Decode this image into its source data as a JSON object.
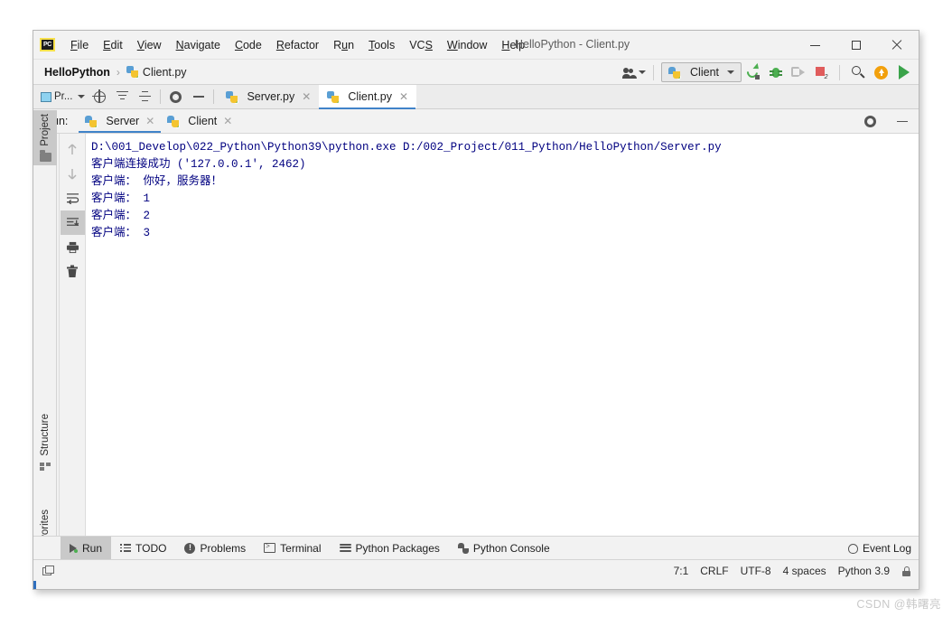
{
  "window": {
    "title": "HelloPython - Client.py",
    "logo_text": "PC",
    "controls": {
      "minimize": "minimize-icon",
      "maximize": "maximize-icon",
      "close": "close-icon"
    }
  },
  "menubar": {
    "items": [
      {
        "label": "File",
        "mnemonic": "F"
      },
      {
        "label": "Edit",
        "mnemonic": "E"
      },
      {
        "label": "View",
        "mnemonic": "V"
      },
      {
        "label": "Navigate",
        "mnemonic": "N"
      },
      {
        "label": "Code",
        "mnemonic": "C"
      },
      {
        "label": "Refactor",
        "mnemonic": "R"
      },
      {
        "label": "Run",
        "mnemonic": "u"
      },
      {
        "label": "Tools",
        "mnemonic": "T"
      },
      {
        "label": "VCS",
        "mnemonic": "S"
      },
      {
        "label": "Window",
        "mnemonic": "W"
      },
      {
        "label": "Help",
        "mnemonic": "H"
      }
    ]
  },
  "navbar": {
    "project": "HelloPython",
    "separator": "›",
    "file": "Client.py",
    "run_config": "Client",
    "icons": {
      "people": "people-icon",
      "rerun": "run-icon",
      "debug": "debug-icon",
      "coverage": "run-with-coverage-icon",
      "stop": "stop-icon",
      "search": "search-everywhere-icon",
      "update": "update-icon",
      "play": "play-icon"
    }
  },
  "editor_tabbar": {
    "project_chip": "Pr...",
    "tools": [
      "locate-icon",
      "expand-all-icon",
      "collapse-all-icon",
      "settings-icon",
      "hide-icon"
    ],
    "tabs": [
      {
        "label": "Server.py",
        "active": false
      },
      {
        "label": "Client.py",
        "active": true
      }
    ]
  },
  "run_window": {
    "label": "Run:",
    "tabs": [
      {
        "label": "Server",
        "active": true
      },
      {
        "label": "Client",
        "active": false
      }
    ],
    "header_icons": [
      "settings-icon",
      "hide-icon"
    ],
    "left_toolbar": [
      "rerun-icon",
      "wrench-icon",
      "stop-icon",
      "layout-icon",
      "pin-icon"
    ],
    "right_toolbar": [
      "up-arrow-icon",
      "down-arrow-icon",
      "soft-wrap-icon",
      "scroll-to-end-icon",
      "print-icon",
      "trash-icon"
    ],
    "console_lines": [
      "D:\\001_Develop\\022_Python\\Python39\\python.exe D:/002_Project/011_Python/HelloPython/Server.py",
      "客户端连接成功 ('127.0.0.1', 2462)",
      "客户端： 你好，服务器！",
      "客户端： 1",
      "客户端： 2",
      "客户端： 3"
    ],
    "console_text_color": "#000080"
  },
  "left_stripe": {
    "items": [
      {
        "label": "Project",
        "icon": "folder-icon",
        "selected": true
      },
      {
        "label": "Structure",
        "icon": "structure-icon",
        "selected": false
      },
      {
        "label": "Favorites",
        "icon": "star-icon",
        "selected": false
      }
    ]
  },
  "bottom_bar": {
    "items": [
      {
        "label": "Run",
        "icon": "run-icon",
        "selected": true
      },
      {
        "label": "TODO",
        "icon": "todo-icon",
        "selected": false
      },
      {
        "label": "Problems",
        "icon": "problems-icon",
        "selected": false
      },
      {
        "label": "Terminal",
        "icon": "terminal-icon",
        "selected": false
      },
      {
        "label": "Python Packages",
        "icon": "packages-icon",
        "selected": false
      },
      {
        "label": "Python Console",
        "icon": "python-console-icon",
        "selected": false
      }
    ],
    "event_log": "Event Log",
    "event_log_icon": "bell-icon"
  },
  "status_bar": {
    "window_icon": "window-icon",
    "caret": "7:1",
    "line_separator": "CRLF",
    "encoding": "UTF-8",
    "indent": "4 spaces",
    "interpreter": "Python 3.9",
    "lock_icon": "lock-icon"
  },
  "watermark": "CSDN @韩曙亮",
  "colors": {
    "accent": "#4083c9",
    "chrome": "#f2f2f2",
    "selected": "#c9c9c9",
    "console_bg": "#ffffff",
    "console_fg": "#000080"
  }
}
